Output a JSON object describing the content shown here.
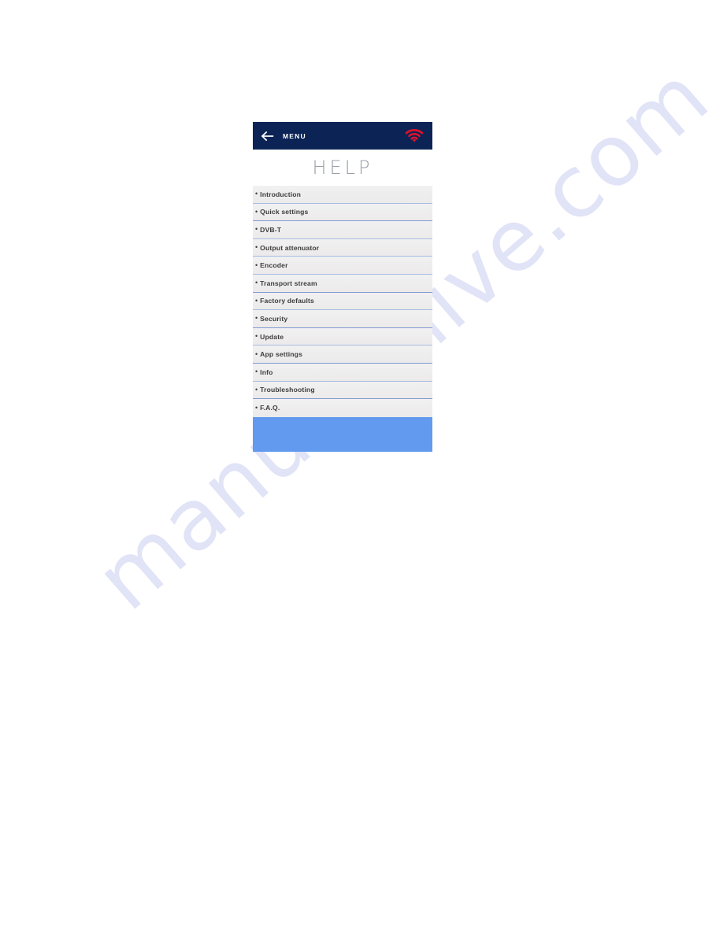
{
  "watermark": {
    "text": "manualshive.com"
  },
  "navbar": {
    "back_label": "back-arrow",
    "menu_label": "MENU",
    "wifi_label": "wifi-signal",
    "bg_color": "#0c2455",
    "wifi_color": "#e4102a"
  },
  "header": {
    "title": "HELP"
  },
  "help_menu": {
    "bullet": "•",
    "items": [
      {
        "label": "Introduction"
      },
      {
        "label": "Quick settings"
      },
      {
        "label": "DVB-T"
      },
      {
        "label": "Output attenuator"
      },
      {
        "label": "Encoder"
      },
      {
        "label": "Transport stream"
      },
      {
        "label": "Factory defaults"
      },
      {
        "label": "Security"
      },
      {
        "label": "Update"
      },
      {
        "label": "App settings"
      },
      {
        "label": "Info"
      },
      {
        "label": "Troubleshooting"
      },
      {
        "label": "F.A.Q."
      }
    ]
  },
  "footer": {
    "text": "",
    "color": "#629af0"
  }
}
